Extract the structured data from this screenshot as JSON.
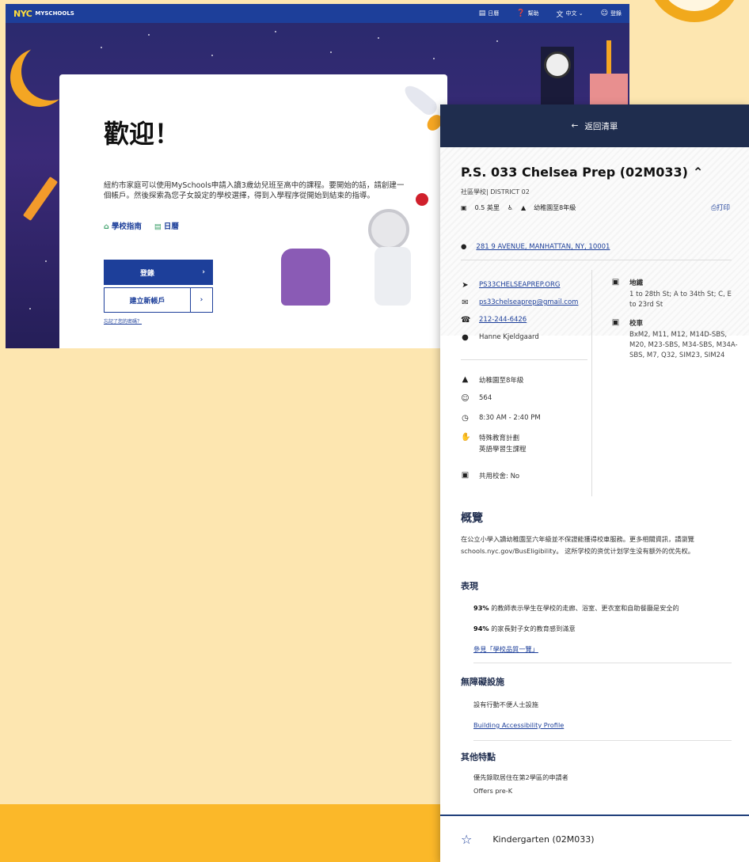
{
  "background": {
    "accent": "#fbb829",
    "cream": "#fde6b0"
  },
  "back_screen": {
    "topbar": {
      "logo": "NYC",
      "logo_text": "MYSCHOOLS",
      "nav": [
        {
          "icon": "calendar-icon",
          "label": "日曆"
        },
        {
          "icon": "help-icon",
          "label": "幫助"
        },
        {
          "icon": "translate-icon",
          "label": "中文 ⌄"
        },
        {
          "icon": "family-icon",
          "label": "登錄"
        }
      ]
    },
    "welcome": {
      "title": "歡迎！",
      "body": "紐約市家庭可以使用MySchools申請入讀3歲幼兒班至高中的課程。要開始的話，請創建一個帳戶。然後探索為您子女設定的學校選擇，得到入學程序從開始到結束的指導。",
      "link_guide": "學校指南",
      "link_calendar": "日曆",
      "login_button": "登錄",
      "create_button": "建立新帳戶",
      "forgot_link": "忘記了您的密碼？"
    }
  },
  "panel": {
    "back_label": "返回清單",
    "school_name": "P.S. 033 Chelsea Prep (02M033)",
    "school_type": "社區學校| DISTRICT 02",
    "distance": "0.5 英里",
    "grades_short": "幼稚園至8年級",
    "print_label": "打印",
    "address": "281 9 AVENUE, MANHATTAN, NY, 10001",
    "contacts": {
      "website": "PS33CHELSEAPREP.ORG",
      "email": "ps33chelseaprep@gmail.com",
      "phone": "212-244-6426",
      "principal": "Hanne Kjeldgaard"
    },
    "facts": {
      "grades": "幼稚園至8年級",
      "enrollment": "564",
      "hours": "8:30 AM - 2:40 PM",
      "programs_1": "特殊教育計劃",
      "programs_2": "英語學習生課程",
      "shared_campus": "共用校舍: No"
    },
    "transit": {
      "subway_title": "地鐵",
      "subway_detail": "1 to 28th St; A to 34th St; C, E to 23rd St",
      "bus_title": "校車",
      "bus_detail": "BxM2, M11, M12, M14D-SBS, M20, M23-SBS, M34-SBS, M34A-SBS, M7, Q32, SIM23, SIM24"
    },
    "overview": {
      "title": "概覽",
      "text": "在公立小學入讀幼稚園至六年級並不保證能獲得校車服務。更多相關資訊，請瀏覽 schools.nyc.gov/BusEligibility。 这所学校的资优计划学生没有额外的优先权。"
    },
    "performance": {
      "title": "表現",
      "stat1_value": "93%",
      "stat1_text": " 的教師表示學生在學校的走廊、浴室、更衣室和自助餐廳是安全的",
      "stat2_value": "94%",
      "stat2_text": " 的家長對子女的教育感到滿意",
      "link": "參見「學校品質一覽」"
    },
    "accessibility": {
      "title": "無障礙設施",
      "text": "設有行動不便人士設施",
      "link": "Building Accessibility Profile"
    },
    "other": {
      "title": "其他特點",
      "item1": "優先錄取居住在第2學區的申請者",
      "item2": "Offers pre-K"
    },
    "program": "Kindergarten (02M033)"
  }
}
